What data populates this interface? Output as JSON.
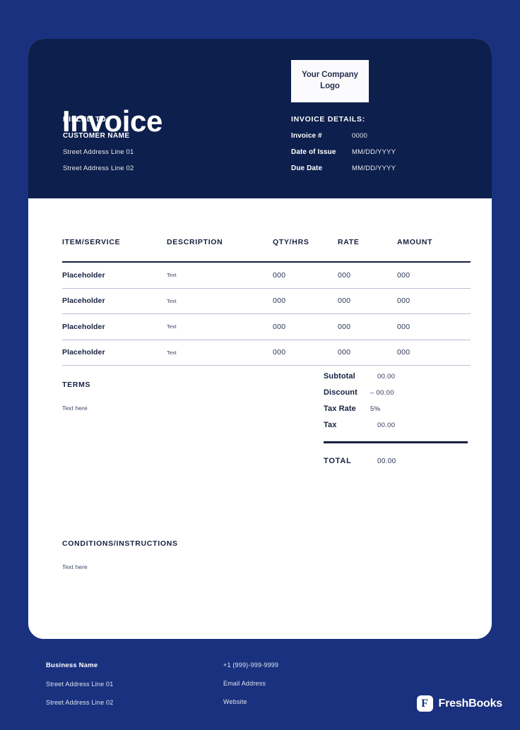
{
  "colors": {
    "page_background": "#19317e",
    "header_background": "#0d1f4c",
    "card_background": "#ffffff",
    "text_dark": "#17203f",
    "accent_rule": "#16203f"
  },
  "header": {
    "title": "Invoice",
    "billed_to_label": "BILLED TO:",
    "customer_name": "CUSTOMER NAME",
    "address_lines": [
      "Street Address Line 01",
      "Street Address Line 02"
    ],
    "logo_placeholder": "Your Company Logo",
    "details_label": "INVOICE DETAILS:",
    "details": [
      {
        "key": "Invoice #",
        "value": "0000"
      },
      {
        "key": "Date of Issue",
        "value": "MM/DD/YYYY"
      },
      {
        "key": "Due Date",
        "value": "MM/DD/YYYY"
      }
    ]
  },
  "table": {
    "columns": [
      "ITEM/SERVICE",
      "DESCRIPTION",
      "QTY/HRS",
      "RATE",
      "AMOUNT"
    ],
    "rows": [
      {
        "item": "Placeholder",
        "description": "Text",
        "qty": "000",
        "rate": "000",
        "amount": "000"
      },
      {
        "item": "Placeholder",
        "description": "Text",
        "qty": "000",
        "rate": "000",
        "amount": "000"
      },
      {
        "item": "Placeholder",
        "description": "Text",
        "qty": "000",
        "rate": "000",
        "amount": "000"
      },
      {
        "item": "Placeholder",
        "description": "Text",
        "qty": "000",
        "rate": "000",
        "amount": "000"
      }
    ]
  },
  "terms": {
    "title": "TERMS",
    "text": "Text here"
  },
  "conditions": {
    "title": "CONDITIONS/INSTRUCTIONS",
    "text": "Text here"
  },
  "totals": {
    "rows": [
      {
        "label": "Subtotal",
        "value": "00.00"
      },
      {
        "label": "Discount",
        "value": "– 00.00"
      },
      {
        "label": "Tax Rate",
        "value": "5%"
      },
      {
        "label": "Tax",
        "value": "00.00"
      }
    ],
    "total_label": "TOTAL",
    "total_value": "00.00"
  },
  "footer": {
    "business_name": "Business Name",
    "address_lines": [
      "Street Address Line 01",
      "Street Address Line 02"
    ],
    "phone": "+1 (999)-999-9999",
    "email": "Email Address",
    "website": "Website",
    "brand_mark": "F",
    "brand_name": "FreshBooks"
  }
}
